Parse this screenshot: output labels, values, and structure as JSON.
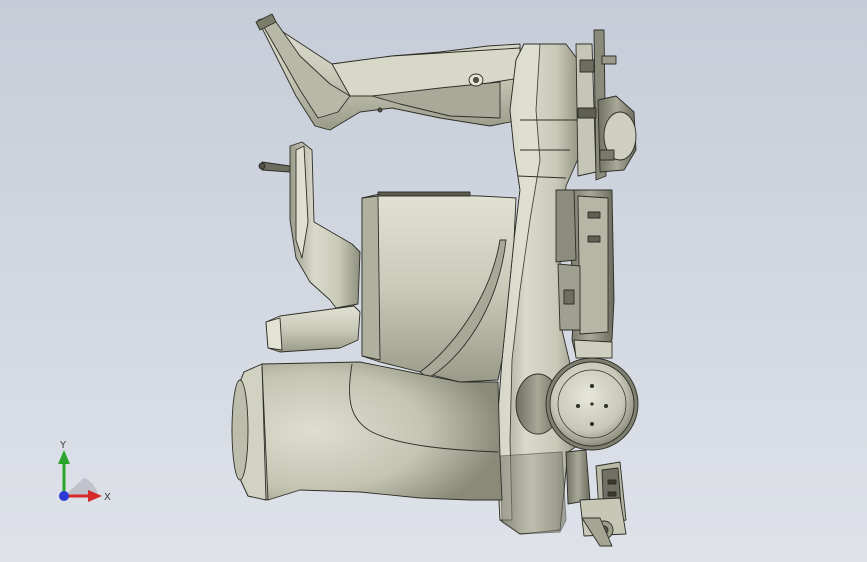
{
  "triad": {
    "x_label": "X",
    "y_label": "Y"
  },
  "colors": {
    "background_top": "#c7cdd8",
    "background_bottom": "#dfe2e9",
    "part_fill": "#cfcfbf",
    "part_shadow": "#8d8d7c",
    "edge": "#2e2e28",
    "x_axis": "#d42a2a",
    "y_axis": "#2aa52a",
    "z_axis": "#2a3ad4"
  },
  "icons": {
    "triad": "coordinate-triad-icon"
  }
}
